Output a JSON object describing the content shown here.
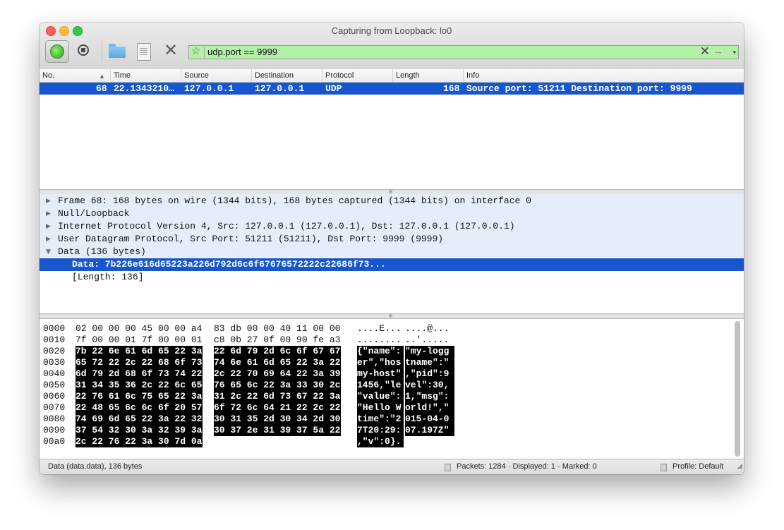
{
  "window": {
    "title": "Capturing from Loopback: lo0"
  },
  "toolbar": {
    "icons": [
      "start-capture-icon",
      "stop-capture-icon",
      "open-folder-icon",
      "file-icon",
      "close-icon"
    ]
  },
  "filter": {
    "value": "udp.port == 9999",
    "bookmark_icon": "star-icon",
    "clear_glyph": "✕",
    "apply_glyph": "→",
    "dropdown_glyph": "▾"
  },
  "packet_list": {
    "columns": [
      "No.",
      "Time",
      "Source",
      "Destination",
      "Protocol",
      "Length",
      "Info"
    ],
    "rows": [
      {
        "no": "68",
        "time": "22.1343210…",
        "source": "127.0.0.1",
        "destination": "127.0.0.1",
        "protocol": "UDP",
        "length": "168",
        "info": "Source port: 51211  Destination port: 9999"
      }
    ]
  },
  "details": {
    "rows": [
      {
        "expander": "▶",
        "text": "Frame 68: 168 bytes on wire (1344 bits), 168 bytes captured (1344 bits) on interface 0"
      },
      {
        "expander": "▶",
        "text": "Null/Loopback"
      },
      {
        "expander": "▶",
        "text": "Internet Protocol Version 4, Src: 127.0.0.1 (127.0.0.1), Dst: 127.0.0.1 (127.0.0.1)"
      },
      {
        "expander": "▶",
        "text": "User Datagram Protocol, Src Port: 51211 (51211), Dst Port: 9999 (9999)"
      },
      {
        "expander": "▼",
        "text": "Data (136 bytes)"
      },
      {
        "expander": "",
        "text": "Data: 7b226e616d65223a226d792d6c6f67676572222c22686f73..."
      },
      {
        "expander": "",
        "text": "[Length: 136]"
      }
    ]
  },
  "bytes": {
    "rows": [
      {
        "offset": "0000",
        "hex1": "02 00 00 00 45 00 00 a4",
        "hex2": "83 db 00 00 40 11 00 00",
        "ascii1": "....E...",
        "ascii2": "....@..."
      },
      {
        "offset": "0010",
        "hex1": "7f 00 00 01 7f 00 00 01",
        "hex2": "c8 0b 27 0f 00 90 fe a3",
        "ascii1": "........",
        "ascii2": "..'....."
      },
      {
        "offset": "0020",
        "hex1": "7b 22 6e 61 6d 65 22 3a",
        "hex2": "22 6d 79 2d 6c 6f 67 67",
        "ascii1": "{\"name\":",
        "ascii2": "\"my-logg"
      },
      {
        "offset": "0030",
        "hex1": "65 72 22 2c 22 68 6f 73",
        "hex2": "74 6e 61 6d 65 22 3a 22",
        "ascii1": "er\",\"hos",
        "ascii2": "tname\":\""
      },
      {
        "offset": "0040",
        "hex1": "6d 79 2d 68 6f 73 74 22",
        "hex2": "2c 22 70 69 64 22 3a 39",
        "ascii1": "my-host\"",
        "ascii2": ",\"pid\":9"
      },
      {
        "offset": "0050",
        "hex1": "31 34 35 36 2c 22 6c 65",
        "hex2": "76 65 6c 22 3a 33 30 2c",
        "ascii1": "1456,\"le",
        "ascii2": "vel\":30,"
      },
      {
        "offset": "0060",
        "hex1": "22 76 61 6c 75 65 22 3a",
        "hex2": "31 2c 22 6d 73 67 22 3a",
        "ascii1": "\"value\":",
        "ascii2": "1,\"msg\":"
      },
      {
        "offset": "0070",
        "hex1": "22 48 65 6c 6c 6f 20 57",
        "hex2": "6f 72 6c 64 21 22 2c 22",
        "ascii1": "\"Hello W",
        "ascii2": "orld!\",\""
      },
      {
        "offset": "0080",
        "hex1": "74 69 6d 65 22 3a 22 32",
        "hex2": "30 31 35 2d 30 34 2d 30",
        "ascii1": "time\":\"2",
        "ascii2": "015-04-0"
      },
      {
        "offset": "0090",
        "hex1": "37 54 32 30 3a 32 39 3a",
        "hex2": "30 37 2e 31 39 37 5a 22",
        "ascii1": "7T20:29:",
        "ascii2": "07.197Z\""
      },
      {
        "offset": "00a0",
        "hex1": "2c 22 76 22 3a 30 7d 0a",
        "hex2": "",
        "ascii1": ",\"v\":0}.",
        "ascii2": ""
      }
    ]
  },
  "status": {
    "field": "Data (data.data), 136 bytes",
    "packets": "Packets: 1284 · Displayed: 1 · Marked: 0",
    "profile": "Profile: Default"
  }
}
